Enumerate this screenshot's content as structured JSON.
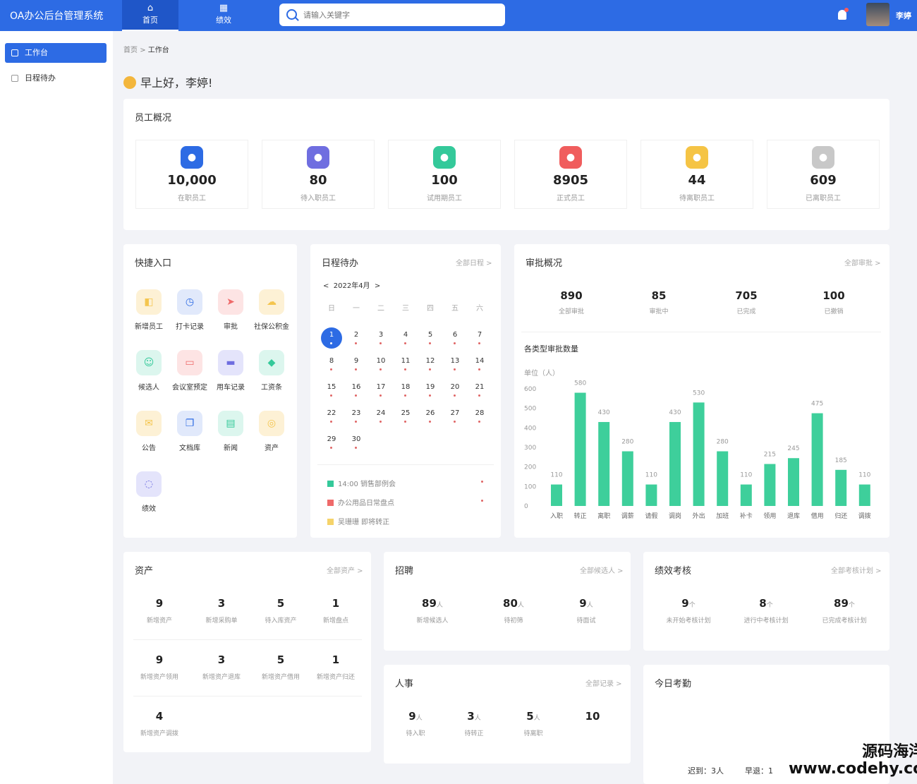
{
  "app_title": "OA办公后台管理系统",
  "nav": [
    {
      "label": "首页",
      "icon": "home-icon"
    },
    {
      "label": "绩效",
      "icon": "grid-icon"
    }
  ],
  "search_placeholder": "请输入关键字",
  "user_name": "李婷",
  "sidebar": [
    {
      "label": "工作台"
    },
    {
      "label": "日程待办"
    }
  ],
  "breadcrumb": {
    "home": "首页",
    "sep": ">",
    "current": "工作台"
  },
  "greeting": "早上好，李婷!",
  "overview": {
    "title": "员工概况",
    "stats": [
      {
        "value": "10,000",
        "label": "在职员工",
        "color": "#2d6be4"
      },
      {
        "value": "80",
        "label": "待入职员工",
        "color": "#6f6ee0"
      },
      {
        "value": "100",
        "label": "试用期员工",
        "color": "#34c99a"
      },
      {
        "value": "8905",
        "label": "正式员工",
        "color": "#f05d5d"
      },
      {
        "value": "44",
        "label": "待离职员工",
        "color": "#f5c445"
      },
      {
        "value": "609",
        "label": "已离职员工",
        "color": "#c8c8c8"
      }
    ]
  },
  "quick": {
    "title": "快捷入口",
    "items": [
      {
        "label": "新增员工",
        "bg": "#fdf1d5",
        "fg": "#f4c54e"
      },
      {
        "label": "打卡记录",
        "bg": "#e1e9fb",
        "fg": "#2d6be4"
      },
      {
        "label": "审批",
        "bg": "#fde4e4",
        "fg": "#ef6a6a"
      },
      {
        "label": "社保公积金",
        "bg": "#fdf1d5",
        "fg": "#f4c54e"
      },
      {
        "label": "候选人",
        "bg": "#dcf6ee",
        "fg": "#34c99a"
      },
      {
        "label": "会议室预定",
        "bg": "#fde4e4",
        "fg": "#ef6a6a"
      },
      {
        "label": "用车记录",
        "bg": "#e4e4fb",
        "fg": "#6f6ee0"
      },
      {
        "label": "工资条",
        "bg": "#dcf6ee",
        "fg": "#34c99a"
      },
      {
        "label": "公告",
        "bg": "#fdf1d5",
        "fg": "#f4c54e"
      },
      {
        "label": "文档库",
        "bg": "#e1e9fb",
        "fg": "#2d6be4"
      },
      {
        "label": "新闻",
        "bg": "#dcf6ee",
        "fg": "#34c99a"
      },
      {
        "label": "资产",
        "bg": "#fdf1d5",
        "fg": "#f4c54e"
      },
      {
        "label": "绩效",
        "bg": "#e4e4fb",
        "fg": "#6f6ee0"
      }
    ]
  },
  "schedule": {
    "title": "日程待办",
    "more": "全部日程 >",
    "month": "2022年4月",
    "prev": "<",
    "next": ">",
    "weekdays": [
      "日",
      "一",
      "二",
      "三",
      "四",
      "五",
      "六"
    ],
    "selected_day": "1",
    "days": [
      "1",
      "2",
      "3",
      "4",
      "5",
      "6",
      "7",
      "8",
      "9",
      "10",
      "11",
      "12",
      "13",
      "14",
      "15",
      "16",
      "17",
      "18",
      "19",
      "20",
      "21",
      "22",
      "23",
      "24",
      "25",
      "26",
      "27",
      "28",
      "29",
      "30"
    ],
    "events": [
      {
        "text": "14:00 销售部例会",
        "color": "#34c99a"
      },
      {
        "text": "办公用品日常盘点",
        "color": "#ef6a6a"
      },
      {
        "text": "吴珊珊 即将转正",
        "color": "#f5d36a"
      }
    ]
  },
  "approval": {
    "title": "审批概况",
    "more": "全部审批 >",
    "stats": [
      {
        "value": "890",
        "label": "全部审批"
      },
      {
        "value": "85",
        "label": "审批中"
      },
      {
        "value": "705",
        "label": "已完成"
      },
      {
        "value": "100",
        "label": "已撤销"
      }
    ],
    "chart_title": "各类型审批数量",
    "unit": "单位（人）"
  },
  "chart_data": {
    "type": "bar",
    "title": "各类型审批数量",
    "ylabel": "单位（人）",
    "ylim": [
      0,
      600
    ],
    "yticks": [
      "0",
      "100",
      "200",
      "300",
      "400",
      "500",
      "600"
    ],
    "categories": [
      "入职",
      "转正",
      "离职",
      "调薪",
      "请假",
      "调岗",
      "外出",
      "加班",
      "补卡",
      "领用",
      "退库",
      "借用",
      "归还",
      "调拨"
    ],
    "values": [
      110,
      580,
      430,
      280,
      110,
      430,
      530,
      280,
      110,
      215,
      245,
      475,
      185,
      110
    ],
    "color": "#3ecf9b"
  },
  "assets": {
    "title": "资产",
    "more": "全部资产 >",
    "items": [
      {
        "value": "9",
        "label": "新增资产"
      },
      {
        "value": "3",
        "label": "新增采购单"
      },
      {
        "value": "5",
        "label": "待入库资产"
      },
      {
        "value": "1",
        "label": "新增盘点"
      },
      {
        "value": "9",
        "label": "新增资产领用"
      },
      {
        "value": "3",
        "label": "新增资产退库"
      },
      {
        "value": "5",
        "label": "新增资产借用"
      },
      {
        "value": "1",
        "label": "新增资产归还"
      },
      {
        "value": "4",
        "label": "新增资产调拨"
      }
    ]
  },
  "recruit": {
    "title": "招聘",
    "more": "全部候选人 >",
    "unit": "人",
    "items": [
      {
        "value": "89",
        "label": "新增候选人"
      },
      {
        "value": "80",
        "label": "待初筛"
      },
      {
        "value": "9",
        "label": "待面试"
      }
    ]
  },
  "perf": {
    "title": "绩效考核",
    "more": "全部考核计划 >",
    "unit": "个",
    "items": [
      {
        "value": "9",
        "label": "未开始考核计划"
      },
      {
        "value": "8",
        "label": "进行中考核计划"
      },
      {
        "value": "89",
        "label": "已完成考核计划"
      }
    ]
  },
  "hr": {
    "title": "人事",
    "more": "全部记录 >",
    "unit": "人",
    "items": [
      {
        "value": "9",
        "label": "待入职"
      },
      {
        "value": "3",
        "label": "待转正"
      },
      {
        "value": "5",
        "label": "待离职"
      },
      {
        "value": "10"
      }
    ]
  },
  "attendance": {
    "title": "今日考勤",
    "late": "迟到：3人",
    "early": "早退：1"
  },
  "watermark": {
    "line1": "源码海洋网",
    "line2": "www.codehy.com"
  }
}
